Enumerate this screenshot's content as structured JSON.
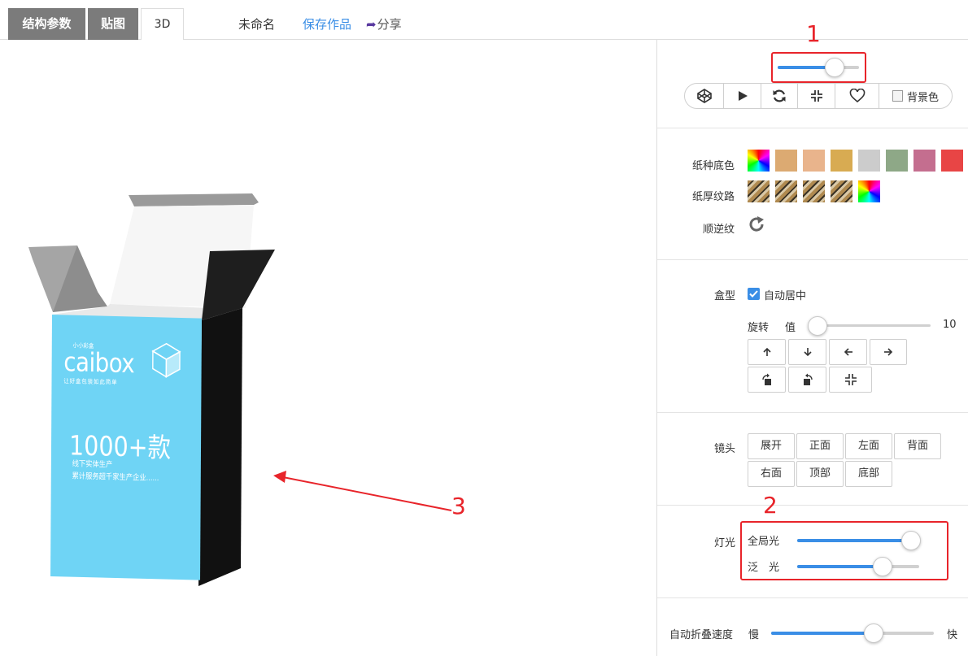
{
  "tabs": [
    {
      "label": "结构参数"
    },
    {
      "label": "贴图"
    },
    {
      "label": "3D"
    }
  ],
  "header": {
    "work_name": "未命名",
    "save_label": "保存作品",
    "share_label": "分享"
  },
  "annotations": {
    "n1": "1",
    "n2": "2",
    "n3": "3"
  },
  "box": {
    "brand": "caibox",
    "brand_prefix": "小小彩盒",
    "slogan": "让好盒包装如此简单",
    "headline": "1000+款",
    "line1": "线下实体生产",
    "line2": "累计服务超千家生产企业......",
    "front_color": "#6fd4f5"
  },
  "toolbar": {
    "bgcolor_label": "背景色",
    "zoom_slider": 0.7,
    "buttons": [
      "codepen-icon",
      "play-icon",
      "refresh-icon",
      "shrink-icon",
      "heart-icon"
    ]
  },
  "paper": {
    "color_label": "纸种底色",
    "colors": [
      "rainbow",
      "#dcaa72",
      "#e9b48c",
      "#d8ab52",
      "#cccccc",
      "#8ea887",
      "#c46e8f",
      "#e84545"
    ],
    "texture_label": "纸厚纹路",
    "textures": [
      "tex",
      "tex",
      "tex",
      "tex",
      "rainbow"
    ],
    "grain_label": "顺逆纹"
  },
  "boxtype": {
    "label": "盒型",
    "auto_center_label": "自动居中",
    "auto_center": true,
    "rotate_label": "旋转",
    "value_label": "值",
    "rotate_value": "10",
    "rotate_slider": 0.07
  },
  "camera": {
    "label": "镜头",
    "views": [
      "展开",
      "正面",
      "左面",
      "背面",
      "右面",
      "顶部",
      "底部"
    ]
  },
  "lighting": {
    "label": "灯光",
    "global_label": "全局光",
    "global_value": 0.93,
    "flood_label": "泛　光",
    "flood_value": 0.7
  },
  "fold": {
    "label": "自动折叠速度",
    "slow_label": "慢",
    "fast_label": "快",
    "speed": 0.63
  },
  "colors": {
    "accent": "#3a8ee6",
    "annotation": "#e8242a",
    "tab_gray": "#7b7b7b"
  }
}
